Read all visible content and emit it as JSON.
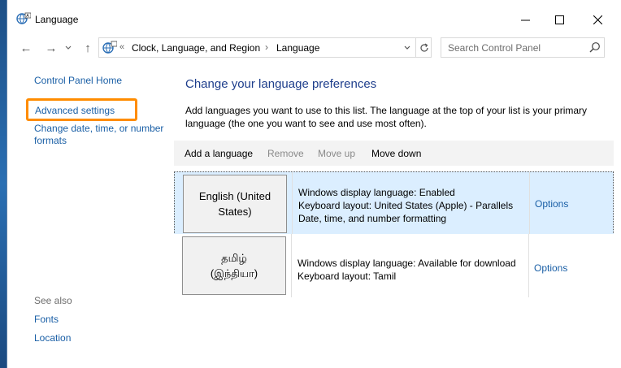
{
  "window": {
    "title": "Language"
  },
  "nav": {
    "back_label": "←",
    "forward_label": "→",
    "recent_label": "⌄",
    "up_label": "↑"
  },
  "address": {
    "chevrons": "«",
    "crumbs": [
      "Clock, Language, and Region",
      "Language"
    ],
    "separator": "›"
  },
  "search": {
    "placeholder": "Search Control Panel"
  },
  "sidebar": {
    "home": "Control Panel Home",
    "advanced": "Advanced settings",
    "date_formats": "Change date, time, or number formats",
    "see_also": "See also",
    "fonts": "Fonts",
    "location": "Location"
  },
  "main": {
    "title": "Change your language preferences",
    "description": "Add languages you want to use to this list. The language at the top of your list is your primary language (the one you want to see and use most often)."
  },
  "toolbar": {
    "add": "Add a language",
    "remove": "Remove",
    "move_up": "Move up",
    "move_down": "Move down"
  },
  "languages": [
    {
      "name_line1": "English (United",
      "name_line2": "States)",
      "info": [
        "Windows display language: Enabled",
        "Keyboard layout: United States (Apple) - Parallels",
        "Date, time, and number formatting"
      ],
      "options": "Options",
      "selected": true
    },
    {
      "name_line1": "தமிழ்",
      "name_line2": "(இந்தியா)",
      "info": [
        "Windows display language: Available for download",
        "Keyboard layout: Tamil"
      ],
      "options": "Options",
      "selected": false
    }
  ],
  "colors": {
    "link": "#1a5fa6",
    "title": "#1e3e8c",
    "selected_row": "#dbeeff",
    "highlight_box": "#ff8c00",
    "disabled_text": "#8a8a8a"
  },
  "icons": {
    "app": "language-globe-icon",
    "minimize": "minimize-icon",
    "maximize": "maximize-icon",
    "close": "close-icon",
    "refresh": "refresh-icon",
    "search": "search-icon",
    "dropdown": "chevron-down-icon"
  }
}
